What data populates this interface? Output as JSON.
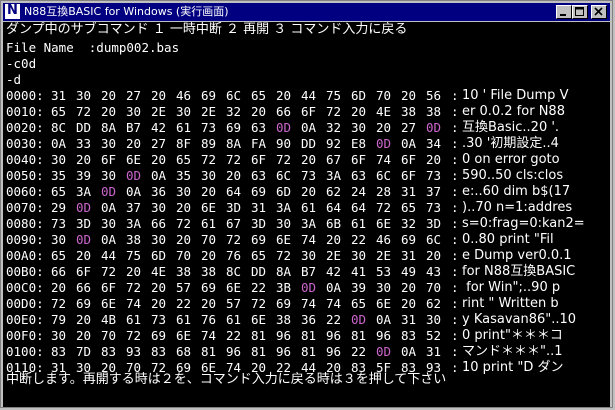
{
  "window": {
    "title": "N88互換BASIC for Windows (実行画面)"
  },
  "titlebar_buttons": {
    "minimize": "minimize",
    "maximize": "maximize",
    "close": "close"
  },
  "colors": {
    "title_bg": "#000080",
    "screen_bg": "#000000",
    "text": "#ffffff",
    "marker": "#cc66cc"
  },
  "console": {
    "header": "ダンプ中のサブコマンド １ 一時中断 ２ 再開 ３ コマンド入力に戻る",
    "file_name": "File Name  :dump002.bas",
    "cmd1": "-c0d",
    "cmd2": "-d",
    "rows": [
      {
        "addr": "0000:",
        "bytes": [
          "31",
          "30",
          "20",
          "27",
          "20",
          "46",
          "69",
          "6C",
          "65",
          "20",
          "44",
          "75",
          "6D",
          "70",
          "20",
          "56"
        ],
        "ascii": "10 ' File Dump V"
      },
      {
        "addr": "0010:",
        "bytes": [
          "65",
          "72",
          "20",
          "30",
          "2E",
          "30",
          "2E",
          "32",
          "20",
          "66",
          "6F",
          "72",
          "20",
          "4E",
          "38",
          "38"
        ],
        "ascii": "er 0.0.2 for N88"
      },
      {
        "addr": "0020:",
        "bytes": [
          "8C",
          "DD",
          "8A",
          "B7",
          "42",
          "61",
          "73",
          "69",
          "63",
          "0D",
          "0A",
          "32",
          "30",
          "20",
          "27",
          "0D"
        ],
        "ascii": "互換Basic..20 '."
      },
      {
        "addr": "0030:",
        "bytes": [
          "0A",
          "33",
          "30",
          "20",
          "27",
          "8F",
          "89",
          "8A",
          "FA",
          "90",
          "DD",
          "92",
          "E8",
          "0D",
          "0A",
          "34"
        ],
        "ascii": ".30 '初期設定..4"
      },
      {
        "addr": "0040:",
        "bytes": [
          "30",
          "20",
          "6F",
          "6E",
          "20",
          "65",
          "72",
          "72",
          "6F",
          "72",
          "20",
          "67",
          "6F",
          "74",
          "6F",
          "20"
        ],
        "ascii": "0 on error goto "
      },
      {
        "addr": "0050:",
        "bytes": [
          "35",
          "39",
          "30",
          "0D",
          "0A",
          "35",
          "30",
          "20",
          "63",
          "6C",
          "73",
          "3A",
          "63",
          "6C",
          "6F",
          "73"
        ],
        "ascii": "590..50 cls:clos"
      },
      {
        "addr": "0060:",
        "bytes": [
          "65",
          "3A",
          "0D",
          "0A",
          "36",
          "30",
          "20",
          "64",
          "69",
          "6D",
          "20",
          "62",
          "24",
          "28",
          "31",
          "37"
        ],
        "ascii": "e:..60 dim b$(17"
      },
      {
        "addr": "0070:",
        "bytes": [
          "29",
          "0D",
          "0A",
          "37",
          "30",
          "20",
          "6E",
          "3D",
          "31",
          "3A",
          "61",
          "64",
          "64",
          "72",
          "65",
          "73"
        ],
        "ascii": ")..70 n=1:addres"
      },
      {
        "addr": "0080:",
        "bytes": [
          "73",
          "3D",
          "30",
          "3A",
          "66",
          "72",
          "61",
          "67",
          "3D",
          "30",
          "3A",
          "6B",
          "61",
          "6E",
          "32",
          "3D"
        ],
        "ascii": "s=0:frag=0:kan2="
      },
      {
        "addr": "0090:",
        "bytes": [
          "30",
          "0D",
          "0A",
          "38",
          "30",
          "20",
          "70",
          "72",
          "69",
          "6E",
          "74",
          "20",
          "22",
          "46",
          "69",
          "6C"
        ],
        "ascii": "0..80 print \"Fil"
      },
      {
        "addr": "00A0:",
        "bytes": [
          "65",
          "20",
          "44",
          "75",
          "6D",
          "70",
          "20",
          "76",
          "65",
          "72",
          "30",
          "2E",
          "30",
          "2E",
          "31",
          "20"
        ],
        "ascii": "e Dump ver0.0.1 "
      },
      {
        "addr": "00B0:",
        "bytes": [
          "66",
          "6F",
          "72",
          "20",
          "4E",
          "38",
          "38",
          "8C",
          "DD",
          "8A",
          "B7",
          "42",
          "41",
          "53",
          "49",
          "43"
        ],
        "ascii": "for N88互換BASIC"
      },
      {
        "addr": "00C0:",
        "bytes": [
          "20",
          "66",
          "6F",
          "72",
          "20",
          "57",
          "69",
          "6E",
          "22",
          "3B",
          "0D",
          "0A",
          "39",
          "30",
          "20",
          "70"
        ],
        "ascii": " for Win\";..90 p"
      },
      {
        "addr": "00D0:",
        "bytes": [
          "72",
          "69",
          "6E",
          "74",
          "20",
          "22",
          "20",
          "57",
          "72",
          "69",
          "74",
          "74",
          "65",
          "6E",
          "20",
          "62"
        ],
        "ascii": "rint \" Written b"
      },
      {
        "addr": "00E0:",
        "bytes": [
          "79",
          "20",
          "4B",
          "61",
          "73",
          "61",
          "76",
          "61",
          "6E",
          "38",
          "36",
          "22",
          "0D",
          "0A",
          "31",
          "30"
        ],
        "ascii": "y Kasavan86\"..10"
      },
      {
        "addr": "00F0:",
        "bytes": [
          "30",
          "20",
          "70",
          "72",
          "69",
          "6E",
          "74",
          "22",
          "81",
          "96",
          "81",
          "96",
          "81",
          "96",
          "83",
          "52"
        ],
        "ascii": "0 print\"＊＊＊コ"
      },
      {
        "addr": "0100:",
        "bytes": [
          "83",
          "7D",
          "83",
          "93",
          "83",
          "68",
          "81",
          "96",
          "81",
          "96",
          "81",
          "96",
          "22",
          "0D",
          "0A",
          "31"
        ],
        "ascii": "マンド＊＊＊\"..1"
      },
      {
        "addr": "0110:",
        "bytes": [
          "31",
          "30",
          "20",
          "70",
          "72",
          "69",
          "6E",
          "74",
          "20",
          "22",
          "44",
          "20",
          "83",
          "5F",
          "83",
          "93"
        ],
        "ascii": "10 print \"D ダン"
      }
    ],
    "footer": "中断します。再開する時は２を、コマンド入力に戻る時は３を押して下さい"
  }
}
